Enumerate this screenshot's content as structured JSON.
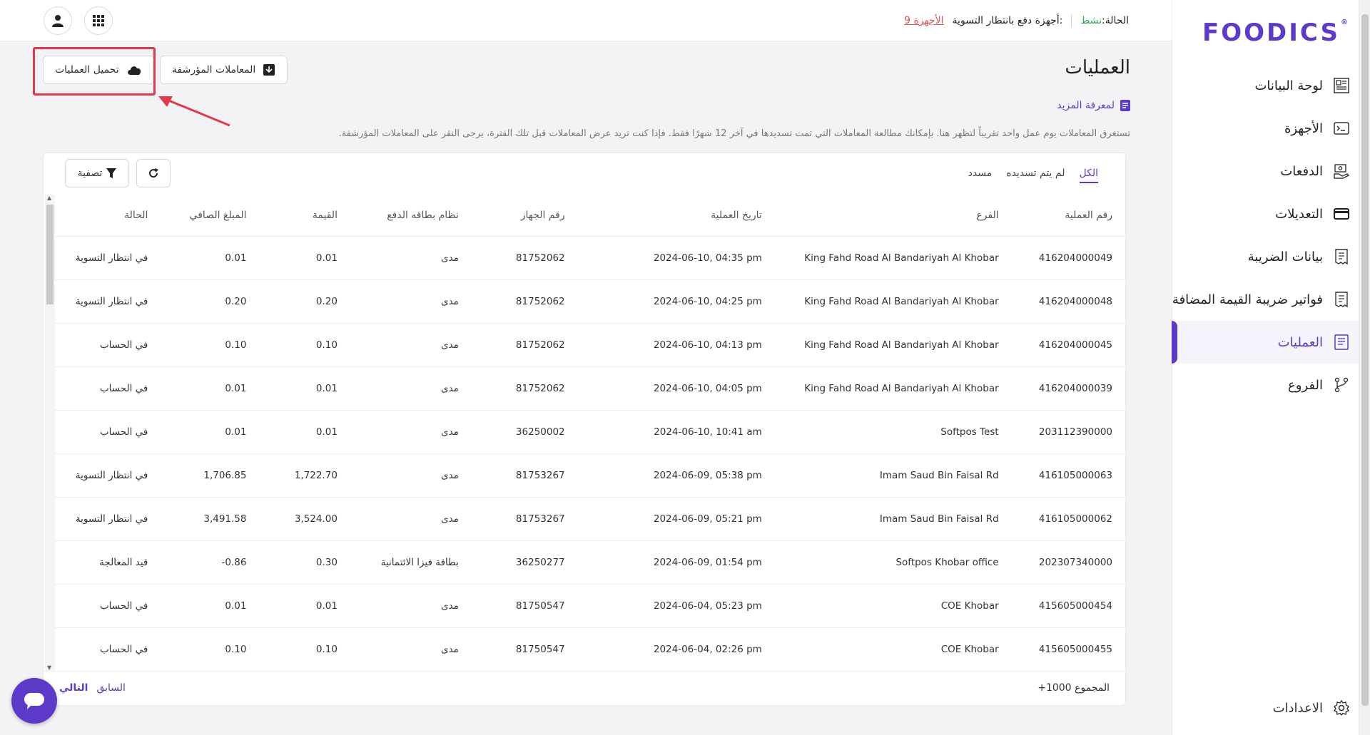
{
  "brand": {
    "logo_text": "FOODICS",
    "logo_mark": "®",
    "accent_color": "#5d3ac9"
  },
  "topbar": {
    "status_label": "الحالة:",
    "status_value": "نشط",
    "pending_label": "أجهزة دفع بانتظار التسوية:",
    "pending_link": "9 الأجهزة"
  },
  "sidebar": {
    "items": [
      {
        "label": "لوحة البيانات",
        "icon": "dashboard-icon"
      },
      {
        "label": "الأجهزة",
        "icon": "terminal-icon"
      },
      {
        "label": "الدفعات",
        "icon": "payments-icon"
      },
      {
        "label": "التعديلات",
        "icon": "card-icon"
      },
      {
        "label": "بيانات الضريبة",
        "icon": "tax-document-icon"
      },
      {
        "label": "فواتير ضريبة القيمة المضافة",
        "icon": "vat-invoice-icon"
      },
      {
        "label": "العمليات",
        "icon": "transactions-icon"
      },
      {
        "label": "الفروع",
        "icon": "branches-icon"
      }
    ],
    "settings_label": "الاعدادات"
  },
  "page": {
    "title": "العمليات",
    "learn_more": "لمعرفة المزيد",
    "description": "تستغرق المعاملات يوم عمل واحد تقريباً لتظهر هنا. بإمكانك مطالعة المعاملات التي تمت تسديدها في آخر 12 شهرًا فقط. فإذا كنت تريد عرض المعاملات قبل تلك الفترة، يرجى النقر على المعاملات المؤرشفة.",
    "archived_button": "المعاملات المؤرشفة",
    "download_button": "تحميل العمليات"
  },
  "tabs": [
    "الكل",
    "لم يتم تسديده",
    "مسدد"
  ],
  "filter_label": "تصفية",
  "table": {
    "columns": [
      "رقم العملية",
      "الفرع",
      "تاريخ العملية",
      "رقم الجهاز",
      "نظام بطاقه الدفع",
      "القيمة",
      "المبلغ الصافي",
      "الحالة"
    ],
    "rows": [
      [
        "416204000049",
        "King Fahd Road Al Bandariyah Al Khobar",
        "2024-06-10, 04:35 pm",
        "81752062",
        "مدى",
        "0.01",
        "0.01",
        "في انتظار التسوية"
      ],
      [
        "416204000048",
        "King Fahd Road Al Bandariyah Al Khobar",
        "2024-06-10, 04:25 pm",
        "81752062",
        "مدى",
        "0.20",
        "0.20",
        "في انتظار التسوية"
      ],
      [
        "416204000045",
        "King Fahd Road Al Bandariyah Al Khobar",
        "2024-06-10, 04:13 pm",
        "81752062",
        "مدى",
        "0.10",
        "0.10",
        "في الحساب"
      ],
      [
        "416204000039",
        "King Fahd Road Al Bandariyah Al Khobar",
        "2024-06-10, 04:05 pm",
        "81752062",
        "مدى",
        "0.01",
        "0.01",
        "في الحساب"
      ],
      [
        "203112390000",
        "Softpos Test",
        "2024-06-10, 10:41 am",
        "36250002",
        "مدى",
        "0.01",
        "0.01",
        "في الحساب"
      ],
      [
        "416105000063",
        "Imam Saud Bin Faisal Rd",
        "2024-06-09, 05:38 pm",
        "81753267",
        "مدى",
        "1,722.70",
        "1,706.85",
        "في انتظار التسوية"
      ],
      [
        "416105000062",
        "Imam Saud Bin Faisal Rd",
        "2024-06-09, 05:21 pm",
        "81753267",
        "مدى",
        "3,524.00",
        "3,491.58",
        "في انتظار التسوية"
      ],
      [
        "202307340000",
        "Softpos Khobar office",
        "2024-06-09, 01:54 pm",
        "36250277",
        "بطاقة فيزا الائتمانية",
        "0.30",
        "-0.86",
        "قيد المعالجة"
      ],
      [
        "415605000454",
        "COE Khobar",
        "2024-06-04, 05:23 pm",
        "81750547",
        "مدى",
        "0.01",
        "0.01",
        "في الحساب"
      ],
      [
        "415605000455",
        "COE Khobar",
        "2024-06-04, 02:26 pm",
        "81750547",
        "مدى",
        "0.10",
        "0.10",
        "في الحساب"
      ]
    ]
  },
  "footer": {
    "total": "المجموع 1000+",
    "prev": "السابق",
    "next": "التالي"
  }
}
